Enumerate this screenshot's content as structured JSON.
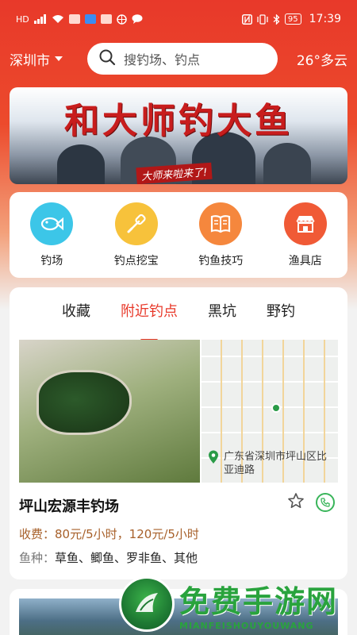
{
  "status_bar": {
    "left_icons": [
      "hd-icon",
      "signal-5g-icon",
      "wifi-icon",
      "app-icon-red",
      "app-icon-blue",
      "app-icon-red-2",
      "ball-icon",
      "chat-icon"
    ],
    "nfc_icon": "nfc-icon",
    "bluetooth_icon": "bluetooth-icon",
    "battery": "95",
    "time": "17:39"
  },
  "header": {
    "city": "深圳市",
    "search_placeholder": "搜钓场、钓点",
    "weather": "26°多云"
  },
  "banner": {
    "title": "和大师钓大鱼",
    "subtitle": "大师来啦来了!"
  },
  "menu": {
    "items": [
      {
        "label": "钓场",
        "icon": "fish-icon",
        "color": "#3cc6e8"
      },
      {
        "label": "钓点挖宝",
        "icon": "shovel-icon",
        "color": "#f7c23b"
      },
      {
        "label": "钓鱼技巧",
        "icon": "book-icon",
        "color": "#f5873d"
      },
      {
        "label": "渔具店",
        "icon": "shop-icon",
        "color": "#f05a36"
      }
    ]
  },
  "tabs": [
    {
      "label": "收藏",
      "active": false
    },
    {
      "label": "附近钓点",
      "active": true
    },
    {
      "label": "黑坑",
      "active": false
    },
    {
      "label": "野钓",
      "active": false
    }
  ],
  "spot": {
    "name": "坪山宏源丰钓场",
    "address": "广东省深圳市坪山区比亚迪路",
    "fee": "收费：80元/5小时，120元/5小时",
    "fish_label": "鱼种：",
    "fish_list": "草鱼、鲫鱼、罗非鱼、其他"
  },
  "watermark": {
    "title": "免费手游网",
    "sub": "MIANFEISHOUYOUWANG"
  },
  "colors": {
    "accent": "#e8392a",
    "fee": "#a7602a",
    "phone": "#39b55a"
  }
}
